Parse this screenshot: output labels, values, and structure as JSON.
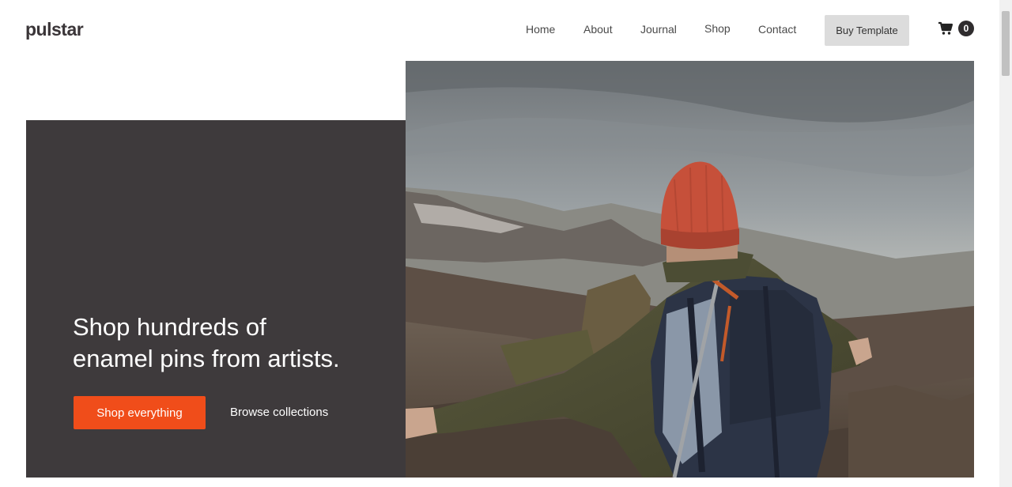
{
  "brand": {
    "logo_text": "pulstar"
  },
  "nav": {
    "items": [
      {
        "label": "Home"
      },
      {
        "label": "About"
      },
      {
        "label": "Journal"
      },
      {
        "label": "Shop"
      },
      {
        "label": "Contact"
      }
    ],
    "buy_label": "Buy Template"
  },
  "cart": {
    "icon": "cart-icon",
    "count": "0"
  },
  "hero": {
    "title_line1": "Shop hundreds of",
    "title_line2": "enamel pins from artists.",
    "primary_cta": "Shop everything",
    "secondary_cta": "Browse collections",
    "image_subject": "hiker-with-backpack-mountains",
    "panel_color": "#3e3a3c",
    "accent_color": "#f04d1a"
  }
}
